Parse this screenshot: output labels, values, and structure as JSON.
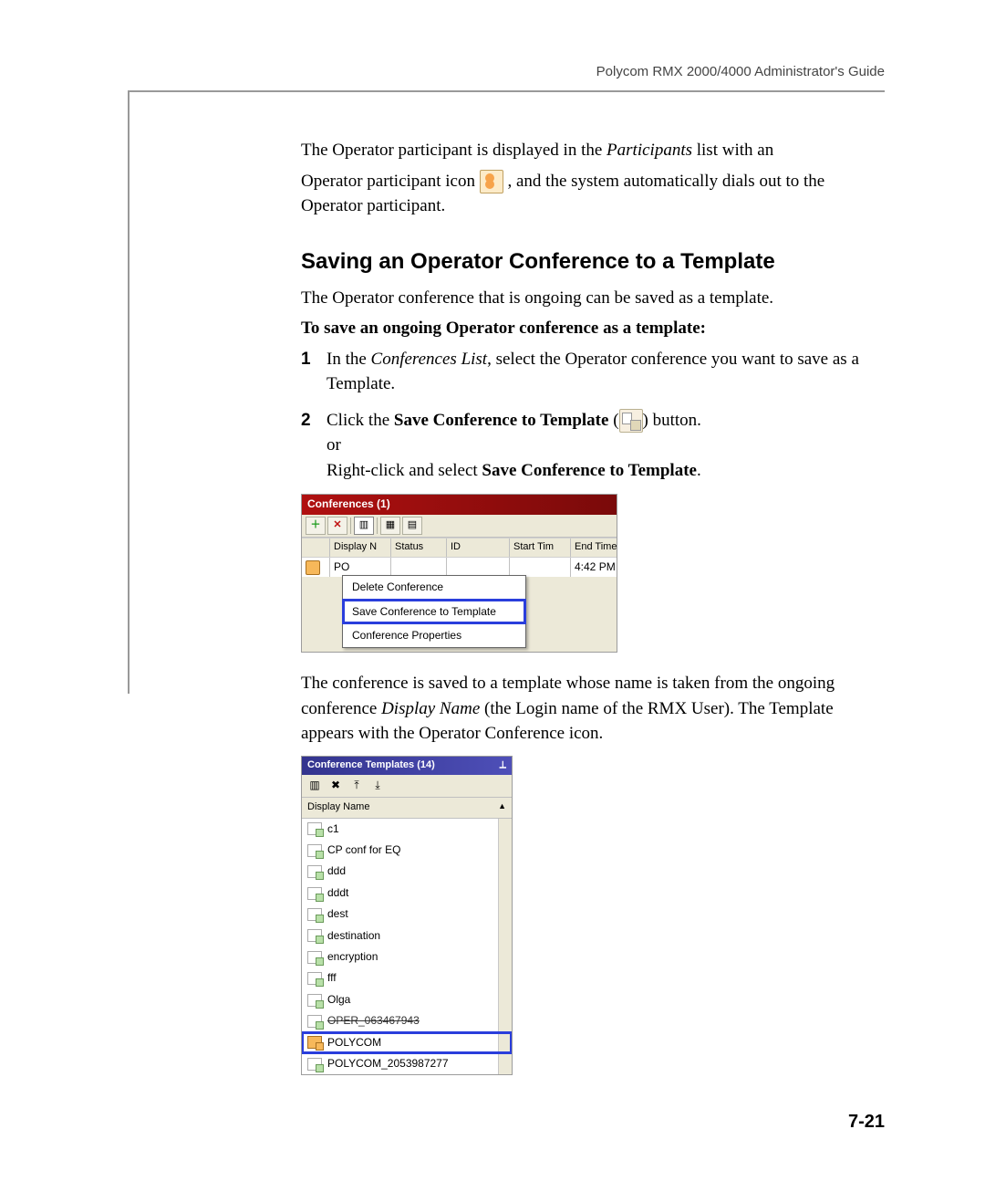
{
  "header": {
    "doc_title": "Polycom RMX 2000/4000 Administrator's Guide"
  },
  "intro": {
    "p1_a": "The Operator participant is displayed in the ",
    "p1_b": "Participants",
    "p1_c": " list with an",
    "p2_a": "Operator participant icon ",
    "p2_b": " , and the system automatically dials out to the Operator participant."
  },
  "section_heading": "Saving an Operator Conference to a Template",
  "section_intro": "The Operator conference that is ongoing can be saved as a template.",
  "procedure_title": "To save an ongoing Operator conference as a template:",
  "steps": {
    "s1_num": "1",
    "s1_a": "In the ",
    "s1_b": "Conferences List",
    "s1_c": ", select the Operator conference you want to save as a Template.",
    "s2_num": "2",
    "s2_a": "Click the ",
    "s2_b": "Save Conference to Template",
    "s2_c": " (",
    "s2_d": ") button.",
    "s2_or": "or",
    "s2_e": "Right-click and select ",
    "s2_f": "Save Conference to Template",
    "s2_g": "."
  },
  "conferences_panel": {
    "title": "Conferences (1)",
    "columns": [
      "Display N",
      "Status",
      "ID",
      "Start Tim",
      "End Time"
    ],
    "row": {
      "name": "PO",
      "end_time": "4:42 PM"
    },
    "context_menu": [
      "Delete Conference",
      "Save Conference to Template",
      "Conference Properties"
    ]
  },
  "after_panel": {
    "p_a": "The conference is saved to a template whose name is taken from the ongoing conference ",
    "p_b": "Display Name",
    "p_c": " (the Login name of the RMX User). The Template appears with the Operator Conference icon."
  },
  "templates_panel": {
    "title": "Conference Templates (14)",
    "column": "Display Name",
    "items": [
      "c1",
      "CP conf for EQ",
      "ddd",
      "dddt",
      "dest",
      "destination",
      "encryption",
      "fff",
      "Olga",
      "OPER_063467943",
      "POLYCOM",
      "POLYCOM_2053987277"
    ],
    "struck_index": 9,
    "highlight_index": 10
  },
  "page_number": "7-21"
}
